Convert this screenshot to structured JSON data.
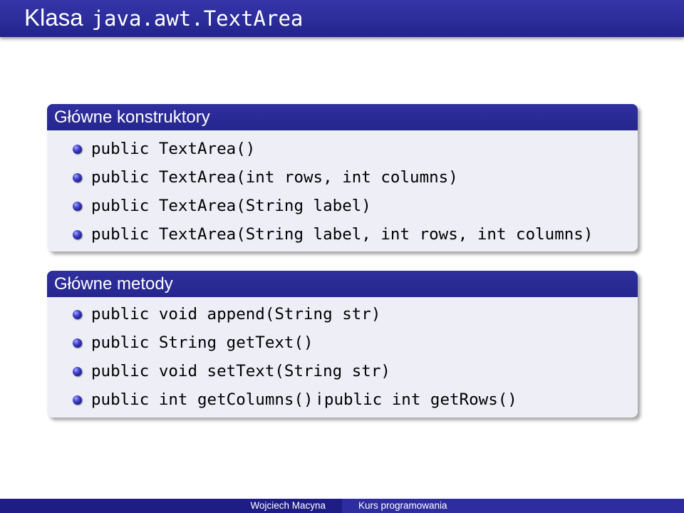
{
  "title": {
    "prefix": "Klasa",
    "code": "java.awt.TextArea"
  },
  "constructors": {
    "header": "Główne konstruktory",
    "items": [
      "public TextArea()",
      "public TextArea(int rows, int columns)",
      "public TextArea(String label)",
      "public TextArea(String label, int rows, int columns)"
    ]
  },
  "methods": {
    "header": "Główne metody",
    "items": [
      "public void append(String str)",
      "public String getText()",
      "public void setText(String str)"
    ],
    "last_item": {
      "part1": "public int getColumns()",
      "conjunction": "i",
      "part2": "public int getRows()"
    }
  },
  "footer": {
    "author": "Wojciech Macyna",
    "course": "Kurs programowania"
  }
}
